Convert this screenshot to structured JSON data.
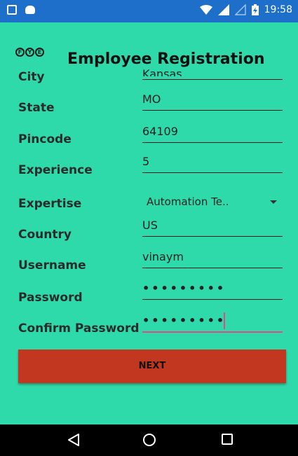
{
  "status_bar": {
    "time": "19:58",
    "icons": [
      "photo-icon",
      "android-icon",
      "wifi-icon",
      "signal-icon",
      "signal-empty-icon",
      "battery-charging-icon"
    ]
  },
  "header": {
    "logo_letters": [
      "F",
      "Y",
      "E"
    ],
    "title": "Employee Registration"
  },
  "fields": {
    "city": {
      "label": "City",
      "value": "Kansas"
    },
    "state": {
      "label": "State",
      "value": "MO"
    },
    "pincode": {
      "label": "Pincode",
      "value": "64109"
    },
    "experience": {
      "label": "Experience",
      "value": "5"
    },
    "expertise": {
      "label": "Expertise",
      "value": "Automation Te.."
    },
    "country": {
      "label": "Country",
      "value": "US"
    },
    "username": {
      "label": "Username",
      "value": "vinaym"
    },
    "password": {
      "label": "Password",
      "value": "•••••••••"
    },
    "confirm_password": {
      "label": "Confirm Password",
      "value": "•••••••••"
    }
  },
  "next_button": {
    "label": "NEXT"
  },
  "colors": {
    "background": "#2fdaaa",
    "status_bar": "#1d6fc9",
    "button": "#c1371f",
    "active_underline": "#e24a86",
    "nav_bar": "#000000"
  },
  "nav": [
    "back-icon",
    "home-icon",
    "recents-icon"
  ]
}
